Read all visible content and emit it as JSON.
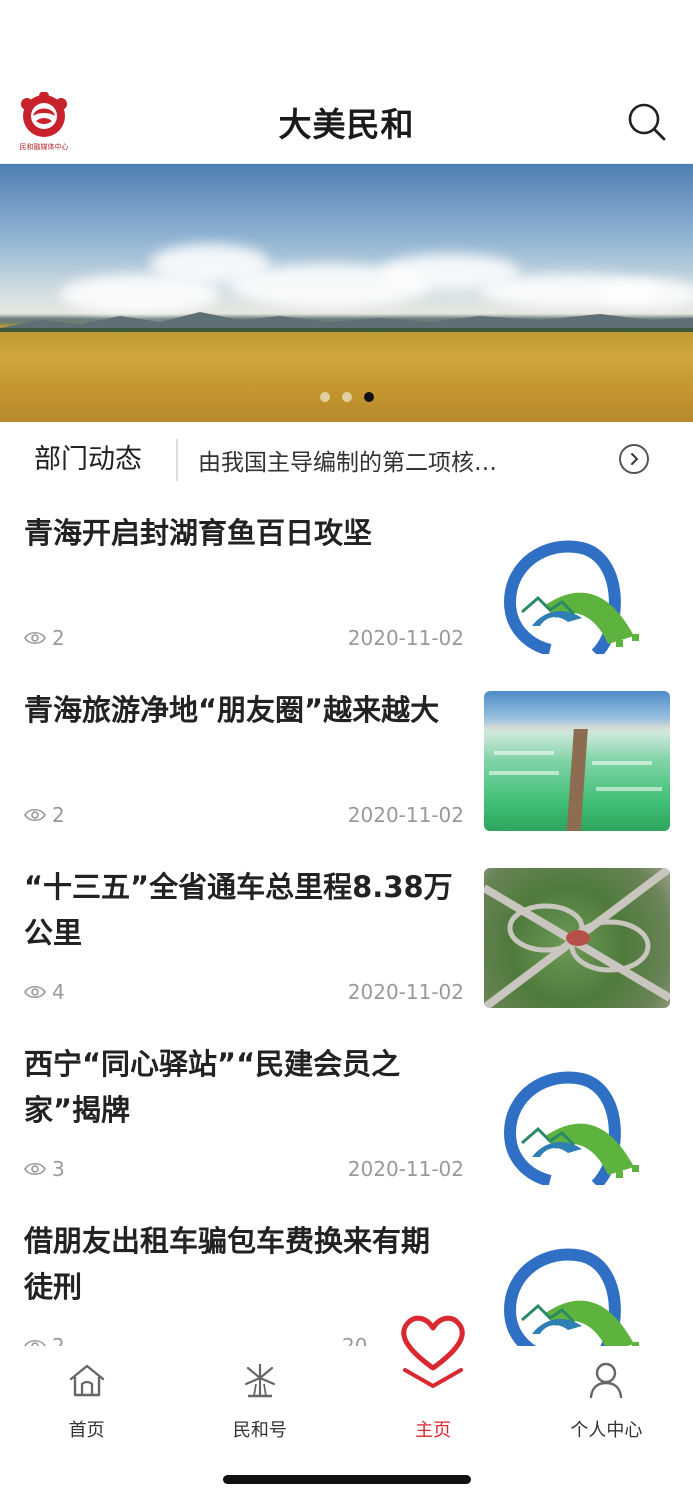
{
  "header": {
    "title": "大美民和",
    "logo_text": "民和融媒体中心",
    "logo_icon": "minhe-media-logo-icon",
    "search_icon": "search-icon"
  },
  "banner": {
    "image": "golden-wheat-field-landscape",
    "slide_count": 3,
    "active_slide": 3
  },
  "ticker": {
    "label": "部门动态",
    "text": "由我国主导编制的第二项核…",
    "arrow_icon": "chevron-right-circle-icon"
  },
  "news": [
    {
      "title": "青海开启封湖育鱼百日攻坚",
      "views": "2",
      "date": "2020-11-02",
      "thumb": "road-logo"
    },
    {
      "title": "青海旅游净地“朋友圈”越来越大",
      "views": "2",
      "date": "2020-11-02",
      "thumb": "salt-lake-photo"
    },
    {
      "title": "“十三五”全省通车总里程8.38万公里",
      "views": "4",
      "date": "2020-11-02",
      "thumb": "highway-interchange-photo"
    },
    {
      "title": "西宁“同心驿站”“民建会员之家”揭牌",
      "views": "3",
      "date": "2020-11-02",
      "thumb": "road-logo"
    },
    {
      "title": "借朋友出租车骗包车费换来有期徒刑",
      "views": "2",
      "date": "20",
      "thumb": "road-logo"
    }
  ],
  "tabbar": {
    "tabs": [
      {
        "label": "首页",
        "icon": "home-icon"
      },
      {
        "label": "民和号",
        "icon": "windmill-icon"
      },
      {
        "label": "主页",
        "icon": "heart-icon",
        "active": true
      },
      {
        "label": "个人中心",
        "icon": "user-icon"
      }
    ],
    "active_color": "#d9282f"
  },
  "colors": {
    "brand_red": "#d9282f",
    "logo_blue": "#2f6fc4",
    "logo_green": "#5db33d"
  }
}
